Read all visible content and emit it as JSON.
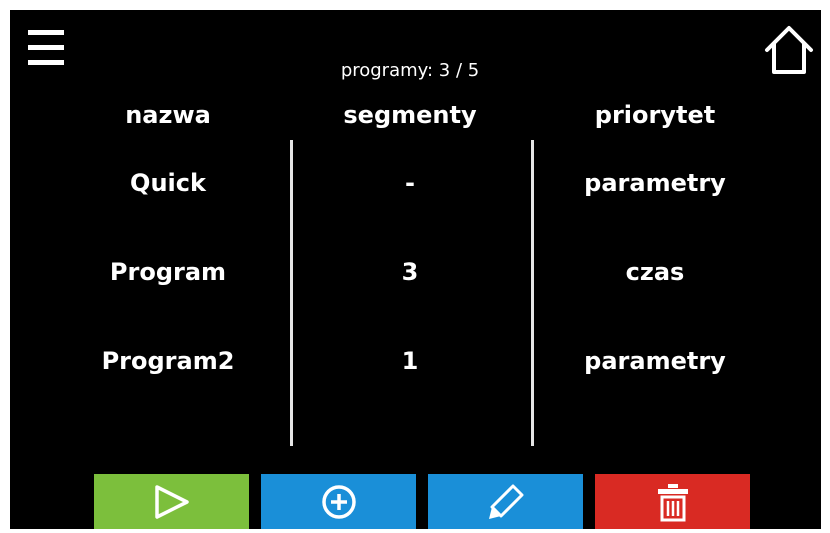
{
  "header": {
    "menu_icon": "hamburger-menu-icon",
    "home_icon": "home-icon",
    "programs_count": "programy: 3 / 5"
  },
  "table": {
    "columns": [
      "nazwa",
      "segmenty",
      "priorytet"
    ],
    "rows": [
      {
        "name": "Quick",
        "segments": "-",
        "priority": "parametry"
      },
      {
        "name": "Program",
        "segments": "3",
        "priority": "czas"
      },
      {
        "name": "Program2",
        "segments": "1",
        "priority": "parametry"
      }
    ]
  },
  "actions": [
    {
      "icon": "play-icon",
      "color": "#7cbf3c"
    },
    {
      "icon": "add-circle-icon",
      "color": "#1a8fd8"
    },
    {
      "icon": "edit-pencil-icon",
      "color": "#1a8fd8"
    },
    {
      "icon": "trash-icon",
      "color": "#d92a23"
    }
  ],
  "colors": {
    "background": "#000000",
    "text": "#ffffff",
    "divider": "#e6e6e6"
  }
}
